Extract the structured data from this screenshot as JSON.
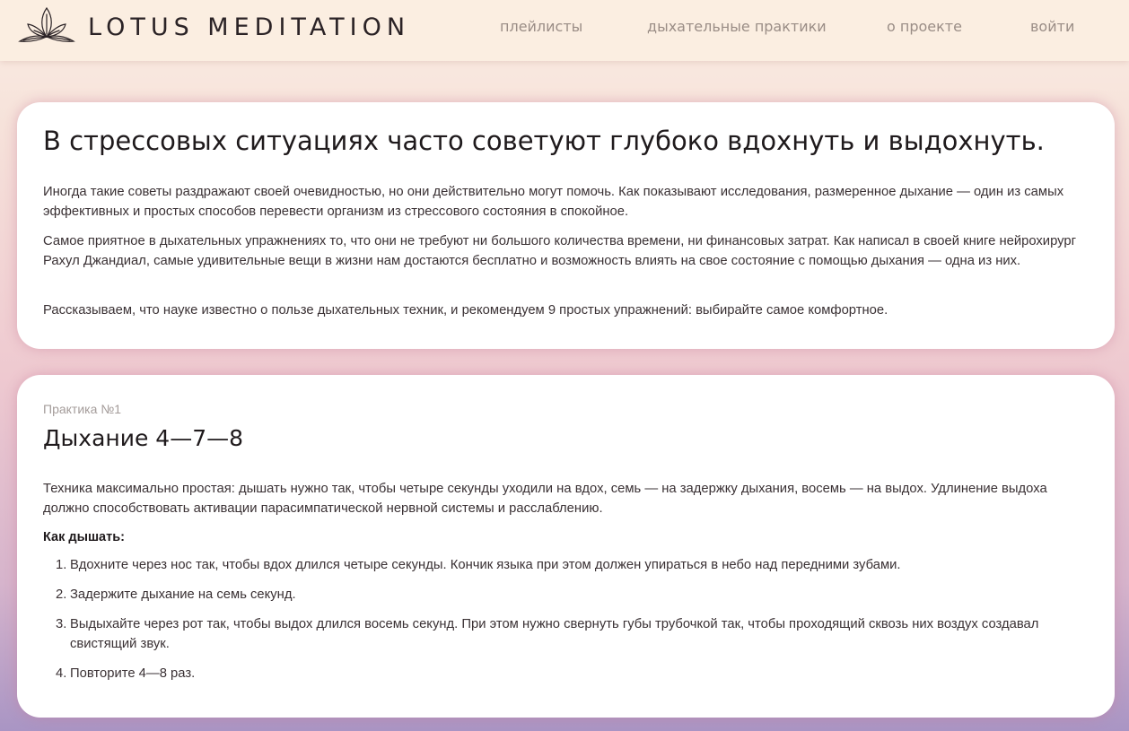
{
  "header": {
    "brand": "LOTUS MEDITATION",
    "logo_icon": "lotus-icon",
    "nav": [
      "плейлисты",
      "дыхательные практики",
      "о проекте",
      "войти"
    ]
  },
  "intro": {
    "title": "В стрессовых ситуациях часто советуют глубоко вдохнуть и выдохнуть.",
    "paragraphs": [
      "Иногда такие советы раздражают своей очевидностью, но они действительно могут помочь. Как показывают исследования, размеренное дыхание — один из самых эффективных и простых способов перевести организм из стрессового состояния в спокойное.",
      "Самое приятное в дыхательных упражнениях то, что они не требуют ни большого количества времени, ни финансовых затрат. Как написал в своей книге нейрохирург Рахул Джандиал, самые удивительные вещи в жизни нам достаются бесплатно и возможность влиять на свое состояние с помощью дыхания — одна из них.",
      "Рассказываем, что науке известно о пользе дыхательных техник, и рекомендуем 9 простых упражнений: выбирайте самое комфортное."
    ]
  },
  "practice": {
    "label": "Практика №1",
    "title": "Дыхание 4—7—8",
    "description": "Техника максимально простая: дышать нужно так, чтобы четыре секунды уходили на вдох, семь — на задержку дыхания, восемь — на выдох. Удлинение выдоха должно способствовать активации парасимпатической нервной системы и расслаблению.",
    "how_label": "Как дышать:",
    "steps": [
      {
        "num": "1.",
        "text": "Вдохните через нос так, чтобы вдох длился четыре секунды. Кончик языка при этом должен упираться в небо над передними зубами."
      },
      {
        "num": "2.",
        "text": "Задержите дыхание на семь секунд."
      },
      {
        "num": "3.",
        "text": "Выдыхайте через рот так, чтобы выдох длился восемь секунд. При этом нужно свернуть губы трубочкой так, чтобы проходящий сквозь них воздух создавал свистящий звук."
      },
      {
        "num": "4.",
        "text": "Повторите 4—8 раз."
      }
    ]
  },
  "colors": {
    "header_bg": "#fbeee1",
    "card_bg": "#ffffff",
    "nav_text": "#9a8d86",
    "muted_label": "#a49c9a"
  }
}
